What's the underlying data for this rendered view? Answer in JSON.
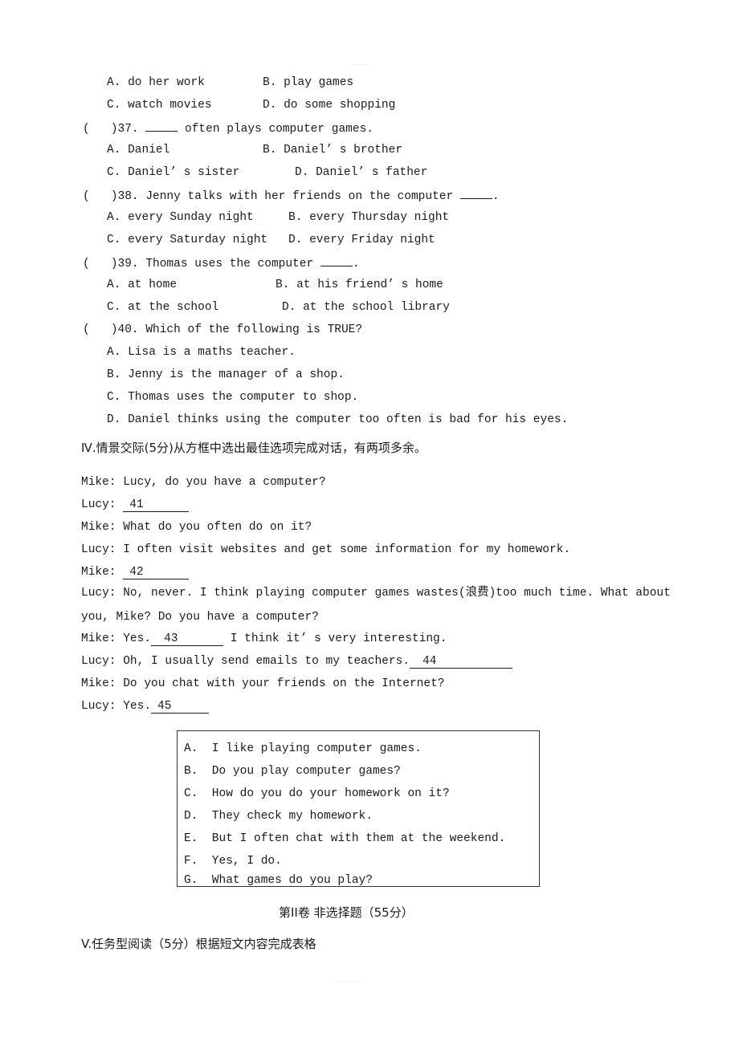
{
  "q36_options": [
    {
      "letter": "A.",
      "text": "do her work"
    },
    {
      "letter": "B.",
      "text": "play games"
    },
    {
      "letter": "C.",
      "text": "watch movies"
    },
    {
      "letter": "D.",
      "text": "do some shopping"
    }
  ],
  "q37": {
    "paren": "(",
    "number": ")37.",
    "stem": "often plays computer games.",
    "options": [
      {
        "letter": "A.",
        "text": "Daniel"
      },
      {
        "letter": "B.",
        "text": "Daniel’ s brother"
      },
      {
        "letter": "C.",
        "text": "Daniel’ s sister"
      },
      {
        "letter": "D.",
        "text": "Daniel’ s father"
      }
    ]
  },
  "q38": {
    "paren": "(",
    "number": ")38.",
    "stem": "Jenny talks with her friends on the computer",
    "end": ".",
    "options": [
      {
        "letter": "A.",
        "text": "every Sunday night"
      },
      {
        "letter": "B.",
        "text": "every Thursday night"
      },
      {
        "letter": "C.",
        "text": "every Saturday night"
      },
      {
        "letter": "D.",
        "text": "every Friday night"
      }
    ]
  },
  "q39": {
    "paren": "(",
    "number": ")39.",
    "stem": "Thomas uses the computer",
    "end": ".",
    "options": [
      {
        "letter": "A.",
        "text": "at home"
      },
      {
        "letter": "B.",
        "text": "at his friend’ s home"
      },
      {
        "letter": "C.",
        "text": "at the school"
      },
      {
        "letter": "D.",
        "text": "at the school library"
      }
    ]
  },
  "q40": {
    "paren": "(",
    "number": ")40.",
    "stem": "Which of the following is TRUE?",
    "options": [
      {
        "letter": "A.",
        "text": "Lisa is a maths teacher."
      },
      {
        "letter": "B.",
        "text": "Jenny is the manager of a shop."
      },
      {
        "letter": "C.",
        "text": "Thomas uses the computer to shop."
      },
      {
        "letter": "D.",
        "text": "Daniel thinks using the computer too often is bad for his eyes."
      }
    ]
  },
  "section4": {
    "heading": "Ⅳ.情景交际(5分)从方框中选出最佳选项完成对话，有两项多余。",
    "dialogue": {
      "l1": "Mike: Lucy, do you have a computer?",
      "l2_speaker": "Lucy: ",
      "l2_blank": "41",
      "l3": "Mike: What do you often do on it?",
      "l4": "Lucy: I often visit websites and get some information for my homework.",
      "l5_speaker": "Mike: ",
      "l5_blank": "42",
      "l6": "Lucy: No, never. I think playing computer games wastes(浪费)too much time. What about",
      "l7": "you, Mike? Do you have a computer?",
      "l8_pre": "Mike: Yes.",
      "l8_blank": "43",
      "l8_post": " I think it’ s very interesting.",
      "l9_pre": "Lucy: Oh, I usually send emails to my teachers.",
      "l9_blank": "44",
      "l10": "Mike: Do you chat with your friends on the Internet?",
      "l11_pre": "Lucy: Yes.",
      "l11_blank": "45"
    },
    "box_options": [
      "A.  I like playing computer games.",
      "B.  Do you play computer games?",
      "C.  How do you do your homework on it?",
      "D.  They check my homework.",
      "E.  But I often chat with them at the weekend.",
      "F.  Yes, I do.",
      "G.  What games do you play?"
    ]
  },
  "part2_title": "第II卷 非选择题（55分）",
  "section5_heading": "V.任务型阅读（5分）根据短文内容完成表格"
}
